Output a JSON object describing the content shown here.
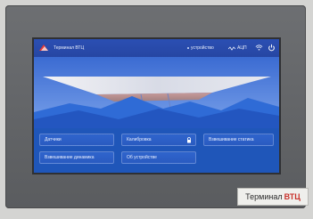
{
  "topbar": {
    "title": "Терминал ВТЦ",
    "status_device": "устройство",
    "status_acp": "АЦП"
  },
  "icons": {
    "logo": "triangle-logo-icon",
    "wifi": "wifi-icon",
    "power": "power-icon",
    "lock": "lock-icon",
    "wave": "signal-wave-icon"
  },
  "tiles": [
    {
      "label": "Датчики"
    },
    {
      "label": "Калибровка"
    },
    {
      "label": "Взвешивание статика"
    },
    {
      "label": "Взвешивание динамика"
    },
    {
      "label": "Об устройстве"
    }
  ],
  "device": {
    "brand_label_1": "Терминал",
    "brand_label_2": "ВТЦ"
  }
}
